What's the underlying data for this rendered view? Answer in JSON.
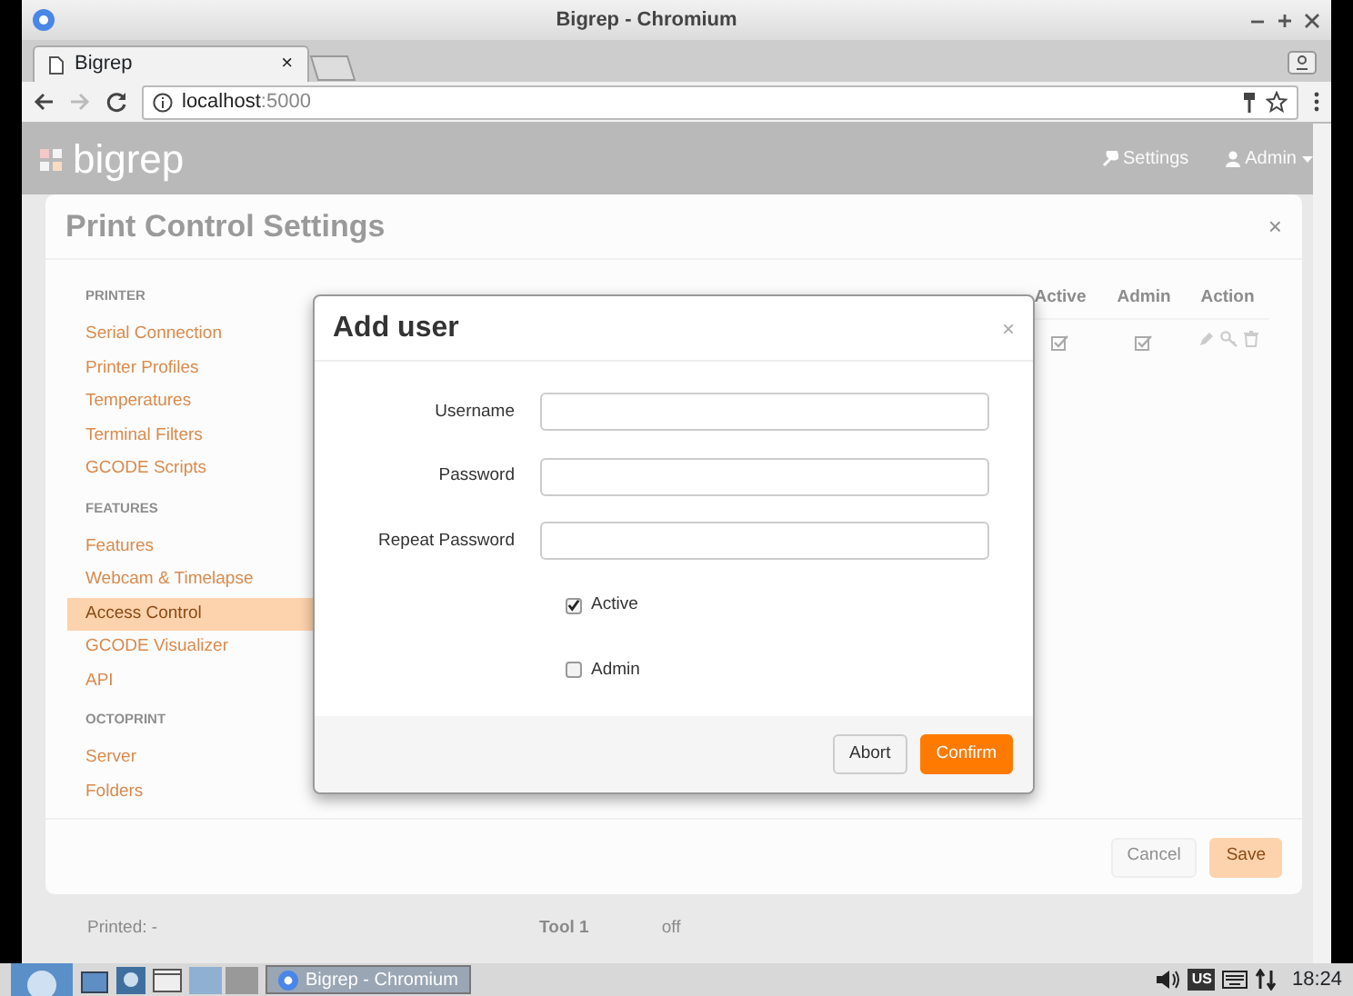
{
  "window": {
    "title": "Bigrep - Chromium"
  },
  "browser": {
    "tab": "Bigrep",
    "tab_close": "×",
    "url_host": "localhost",
    "url_port": ":5000"
  },
  "navbar": {
    "brand": "bigrep",
    "links": [
      {
        "label": "Settings",
        "kind": "settings"
      },
      {
        "label": "Admin",
        "kind": "user"
      }
    ]
  },
  "settings_dialog": {
    "title": "Print Control Settings",
    "close": "×",
    "sidebar": [
      {
        "heading": "PRINTER",
        "items": [
          {
            "label": "Serial Connection",
            "selected": false
          },
          {
            "label": "Printer Profiles",
            "selected": false
          },
          {
            "label": "Temperatures",
            "selected": false
          },
          {
            "label": "Terminal Filters",
            "selected": false
          },
          {
            "label": "GCODE Scripts",
            "selected": false
          }
        ]
      },
      {
        "heading": "FEATURES",
        "items": [
          {
            "label": "Features",
            "selected": false
          },
          {
            "label": "Webcam & Timelapse",
            "selected": false
          },
          {
            "label": "Access Control",
            "selected": true
          },
          {
            "label": "GCODE Visualizer",
            "selected": false
          },
          {
            "label": "API",
            "selected": false
          }
        ]
      },
      {
        "heading": "OCTOPRINT",
        "items": [
          {
            "label": "Server",
            "selected": false
          },
          {
            "label": "Folders",
            "selected": false
          }
        ]
      }
    ],
    "table": {
      "columns": [
        "Active",
        "Admin",
        "Action"
      ],
      "rows": [
        {
          "active": true,
          "admin": true
        }
      ]
    },
    "buttons": [
      "Cancel",
      "Save"
    ]
  },
  "background": {
    "printed": "Printed: -",
    "tool": "Tool 1",
    "state": "off"
  },
  "add_user": {
    "title": "Add user",
    "close": "×",
    "fields": [
      {
        "label": "Username"
      },
      {
        "label": "Password"
      },
      {
        "label": "Repeat Password"
      }
    ],
    "checkboxes": [
      {
        "label": "Active",
        "checked": true
      },
      {
        "label": "Admin",
        "checked": false
      }
    ],
    "buttons": [
      {
        "label": "Abort",
        "kind": "default"
      },
      {
        "label": "Confirm",
        "kind": "primary"
      }
    ]
  },
  "taskbar": {
    "window_button": "Bigrep - Chromium",
    "keyboard": "US",
    "clock": "18:24"
  }
}
